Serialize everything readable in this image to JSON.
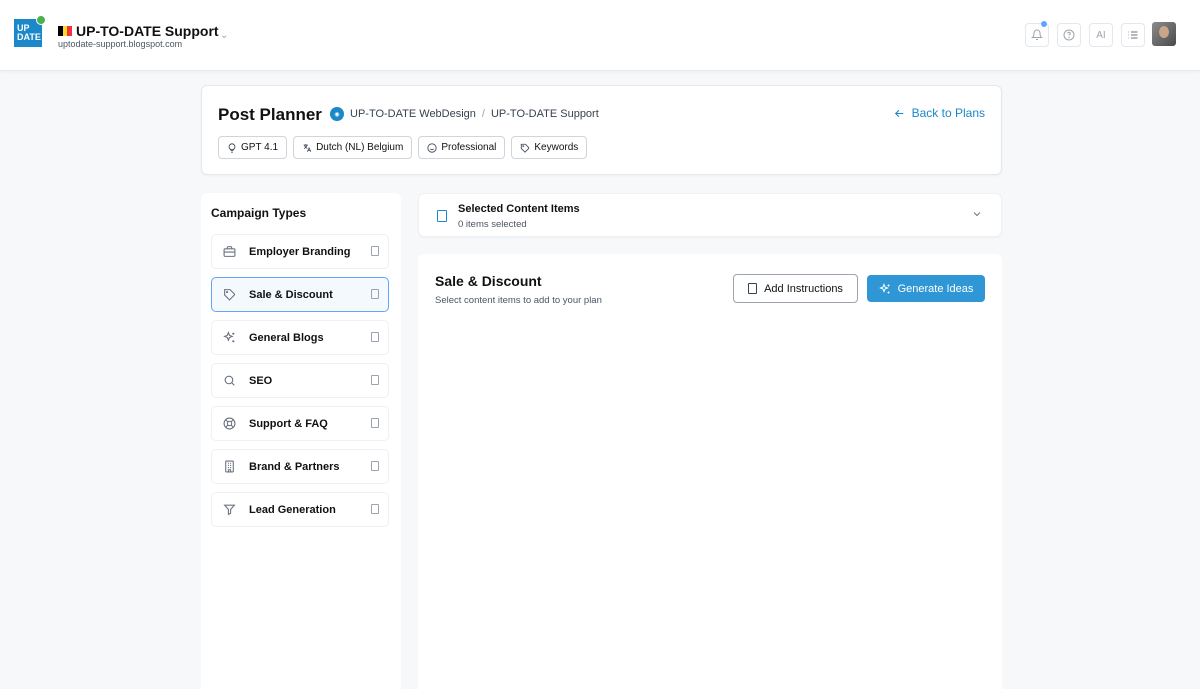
{
  "topbar": {
    "logo_line1": "UP",
    "logo_line2": "DATE",
    "site_name": "UP-TO-DATE Support",
    "site_url": "uptodate-support.blogspot.com",
    "ai_label": "AI",
    "icons": [
      "bell-icon",
      "help-icon",
      "list-icon"
    ]
  },
  "header": {
    "title": "Post Planner",
    "breadcrumb": [
      "UP-TO-DATE WebDesign",
      "UP-TO-DATE Support"
    ],
    "breadcrumb_sep": "/",
    "back_label": "Back to Plans",
    "chips": [
      {
        "label": "GPT 4.1",
        "icon": "bulb-icon"
      },
      {
        "label": "Dutch (NL) Belgium",
        "icon": "translate-icon"
      },
      {
        "label": "Professional",
        "icon": "smile-icon"
      },
      {
        "label": "Keywords",
        "icon": "tag-icon"
      }
    ]
  },
  "sidebar": {
    "title": "Campaign Types",
    "items": [
      {
        "label": "Employer Branding",
        "icon": "briefcase-icon",
        "active": false
      },
      {
        "label": "Sale & Discount",
        "icon": "tag-icon",
        "active": true
      },
      {
        "label": "General Blogs",
        "icon": "sparkles-icon",
        "active": false
      },
      {
        "label": "SEO",
        "icon": "search-icon",
        "active": false
      },
      {
        "label": "Support & FAQ",
        "icon": "lifebuoy-icon",
        "active": false
      },
      {
        "label": "Brand & Partners",
        "icon": "building-icon",
        "active": false
      },
      {
        "label": "Lead Generation",
        "icon": "funnel-icon",
        "active": false
      }
    ]
  },
  "selected": {
    "title": "Selected Content Items",
    "count_text": "0 items selected"
  },
  "main": {
    "title": "Sale & Discount",
    "subtitle": "Select content items to add to your plan",
    "add_instructions_label": "Add Instructions",
    "generate_label": "Generate Ideas"
  },
  "colors": {
    "accent": "#2f97d6",
    "link": "#1a88c9",
    "active_border": "#60a5fa"
  }
}
